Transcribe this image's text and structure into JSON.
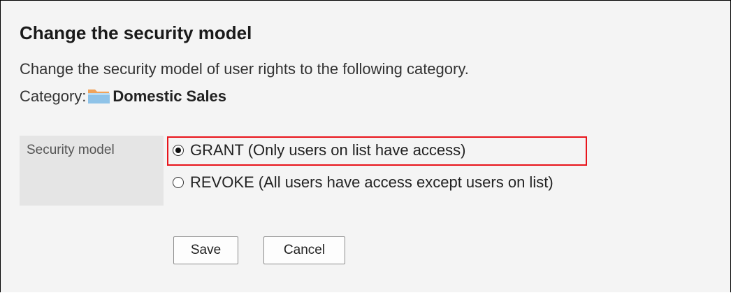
{
  "dialog": {
    "title": "Change the security model",
    "description": "Change the security model of user rights to the following category.",
    "category_label": "Category:",
    "category_icon": "folder-icon",
    "category_name": "Domestic Sales"
  },
  "form": {
    "field_label": "Security model",
    "options": [
      {
        "label": "GRANT (Only users on list have access)",
        "checked": true
      },
      {
        "label": "REVOKE (All users have access except users on list)",
        "checked": false
      }
    ],
    "highlight_color": "#e8141b"
  },
  "buttons": {
    "save_label": "Save",
    "cancel_label": "Cancel"
  }
}
